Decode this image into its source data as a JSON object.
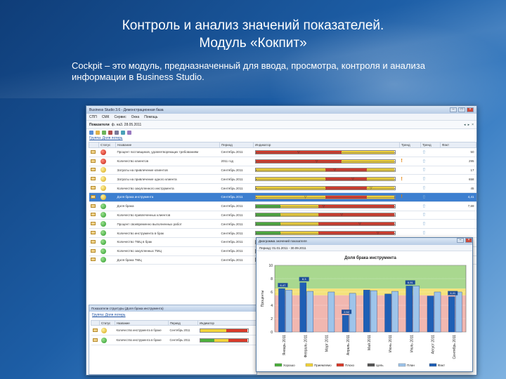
{
  "slide": {
    "title_line1": "Контроль и анализ значений показателей.",
    "title_line2": "Модуль «Кокпит»",
    "subtitle": "Cockpit – это модуль, предназначенный для ввода, просмотра, контроля и анализа информации в Business Studio."
  },
  "window": {
    "title": "Business Studio 3.6 - Демонстрационная база",
    "menu": [
      "СПП",
      "СМК",
      "Сервис",
      "Окна",
      "Помощь"
    ],
    "indicator_label": "Показатели",
    "indicator_value": "ф. на3. 28.05.2011",
    "link": "Группа: Доля потерь",
    "columns": [
      "Статус",
      "Название",
      "Период",
      "Индикатор",
      "Тренд",
      "Тренд",
      "Факт"
    ],
    "rows": [
      {
        "status": "red",
        "name": "Процент поставщиков, удовлетворяющих требованиям",
        "period": "Сентябрь 2011",
        "excl": false,
        "fact": "50",
        "selected": false
      },
      {
        "status": "red",
        "name": "Количество клиентов",
        "period": "2011 год",
        "excl": true,
        "fact": "295",
        "selected": false
      },
      {
        "status": "yellow",
        "name": "Затраты на привлечение клиентов",
        "period": "Сентябрь 2011",
        "excl": false,
        "fact": "17",
        "selected": false
      },
      {
        "status": "yellow",
        "name": "Затраты на привлечение одного клиента",
        "period": "Сентябрь 2011",
        "excl": true,
        "fact": "658",
        "selected": false
      },
      {
        "status": "yellow",
        "name": "Количество закупленного инструмента",
        "period": "Сентябрь 2011",
        "excl": false,
        "fact": "45",
        "selected": false
      },
      {
        "status": "yellow",
        "name": "Доля брака инструмента",
        "period": "Сентябрь 2011",
        "excl": true,
        "fact": "4,41",
        "selected": true
      },
      {
        "status": "green",
        "name": "Доля брака",
        "period": "Сентябрь 2011",
        "excl": false,
        "fact": "7,69",
        "selected": false
      },
      {
        "status": "green",
        "name": "Количество привлеченных клиентов",
        "period": "Сентябрь 2011",
        "excl": false,
        "fact": "",
        "selected": false
      },
      {
        "status": "green",
        "name": "Процент своевременно выполненных работ",
        "period": "Сентябрь 2011",
        "excl": false,
        "fact": "",
        "selected": false
      },
      {
        "status": "green",
        "name": "Количество инструмента в брак",
        "period": "Сентябрь 2011",
        "excl": false,
        "fact": "",
        "selected": false
      },
      {
        "status": "green",
        "name": "Количество ТМЦ в брак",
        "period": "Сентябрь 2011",
        "excl": false,
        "fact": "",
        "selected": false
      },
      {
        "status": "green",
        "name": "Количество закупленных ТМЦ",
        "period": "Сентябрь 2011",
        "excl": false,
        "fact": "",
        "selected": false
      },
      {
        "status": "green",
        "name": "Доля брака ТМЦ",
        "period": "Сентябрь 2011",
        "excl": false,
        "fact": "",
        "selected": false
      }
    ],
    "indicator_colors": {
      "green": "#4caf3c",
      "yellow": "#f2d33a",
      "red": "#d83a2a"
    }
  },
  "subpanel": {
    "title": "Показатели структуры (Доля брака инструмента)",
    "link": "Группа: Доля потерь",
    "columns": [
      "Статус",
      "Название",
      "Период",
      "Индикатор"
    ],
    "rows": [
      {
        "status": "yellow",
        "name": "Количество инструмента в браке",
        "period": "Сентябрь 2011"
      },
      {
        "status": "green",
        "name": "Количество инструмента в браке",
        "period": "Сентябрь 2011"
      }
    ]
  },
  "popup": {
    "title": "Диаграмма значений показателя",
    "toolbar": "Период: 01.01.2011 - 30.09.2011",
    "chart_data": {
      "type": "bar",
      "title": "Доля брака инструмента",
      "ylabel": "Проценты",
      "ylim": [
        0,
        10
      ],
      "yticks": [
        0,
        2,
        4,
        6,
        8,
        10
      ],
      "categories": [
        "Январь 2011",
        "Февраль 2011",
        "Март 2011",
        "Апрель 2011",
        "Май 2011",
        "Июнь 2011",
        "Июль 2011",
        "Август 2011",
        "Сентябрь 2011"
      ],
      "series": [
        {
          "name": "Факт",
          "color": "#1f5fb5",
          "values": [
            6.5,
            7.4,
            null,
            2.5,
            6.3,
            5.7,
            6.9,
            5.4,
            5.3
          ]
        },
        {
          "name": "План",
          "color": "#9ec4ea",
          "values": [
            6.3,
            6.1,
            6.0,
            5.8,
            6.2,
            6.1,
            6.9,
            6.0,
            6.0
          ]
        }
      ],
      "data_labels": [
        "6,47",
        "8,3",
        "",
        "2,52",
        "",
        "",
        "6,91",
        "",
        "4,41"
      ],
      "legend": [
        "Хорошо",
        "Приемлемо",
        "Плохо",
        "Цель",
        "План",
        "Факт"
      ],
      "legend_colors": [
        "#4caf3c",
        "#f2d33a",
        "#d83a2a",
        "#555555",
        "#9ec4ea",
        "#1f5fb5"
      ]
    }
  }
}
